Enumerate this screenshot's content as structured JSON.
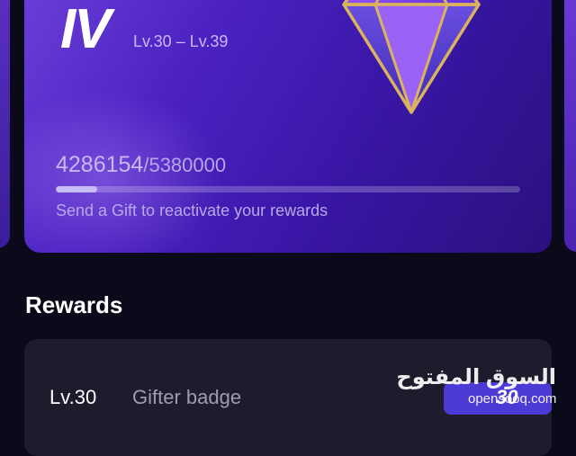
{
  "tier_card": {
    "numeral": "IV",
    "level_range": "Lv.30 – Lv.39",
    "progress_current": "4286154",
    "progress_separator": "/",
    "progress_target": "5380000",
    "progress_fraction": 0.09,
    "hint": "Send a Gift to reactivate your rewards",
    "gem_icon": "diamond-gem-icon"
  },
  "rewards": {
    "title": "Rewards",
    "items": [
      {
        "level": "Lv.30",
        "name": "Gifter badge",
        "badge_value": "30"
      }
    ]
  },
  "watermark": {
    "arabic": "السوق المفتوح",
    "latin": "opensooq.com"
  },
  "colors": {
    "background": "#0b0a1a",
    "card_purple": "#4c22c2",
    "gem_gold": "#d9b45a",
    "badge_blue": "#4c3ad6"
  }
}
